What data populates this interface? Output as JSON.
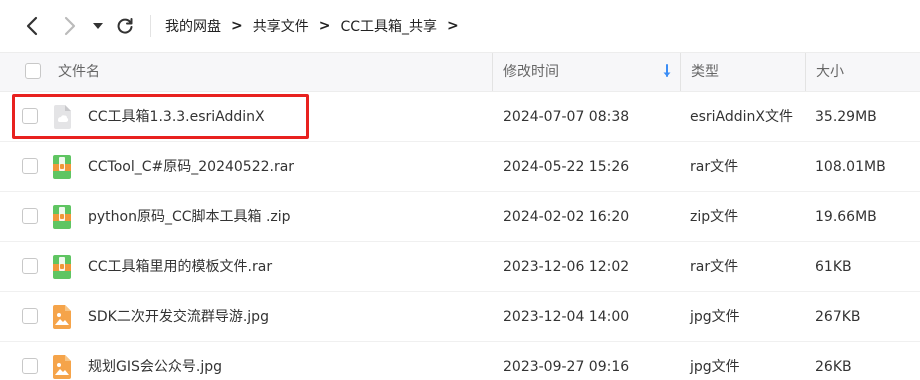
{
  "breadcrumb": [
    "我的网盘",
    "共享文件",
    "CC工具箱_共享"
  ],
  "header": {
    "name": "文件名",
    "time": "修改时间",
    "type": "类型",
    "size": "大小"
  },
  "files": [
    {
      "name": "CC工具箱1.3.3.esriAddinX",
      "time": "2024-07-07 08:38",
      "type": "esriAddinX文件",
      "size": "35.29MB",
      "icon": "esri-addin-icon",
      "highlighted": true
    },
    {
      "name": "CCTool_C#原码_20240522.rar",
      "time": "2024-05-22 15:26",
      "type": "rar文件",
      "size": "108.01MB",
      "icon": "archive-icon"
    },
    {
      "name": "python原码_CC脚本工具箱 .zip",
      "time": "2024-02-02 16:20",
      "type": "zip文件",
      "size": "19.66MB",
      "icon": "archive-icon"
    },
    {
      "name": "CC工具箱里用的模板文件.rar",
      "time": "2023-12-06 12:02",
      "type": "rar文件",
      "size": "61KB",
      "icon": "archive-icon"
    },
    {
      "name": "SDK二次开发交流群导游.jpg",
      "time": "2023-12-04 14:00",
      "type": "jpg文件",
      "size": "267KB",
      "icon": "image-icon"
    },
    {
      "name": "规划GIS会公众号.jpg",
      "time": "2023-09-27 09:16",
      "type": "jpg文件",
      "size": "26KB",
      "icon": "image-icon"
    }
  ],
  "colors": {
    "highlight": "#e8211f",
    "sort_arrow": "#3b8df5",
    "archive_green": "#5fc562",
    "archive_orange": "#f0983a",
    "image_orange": "#f5a44a"
  }
}
